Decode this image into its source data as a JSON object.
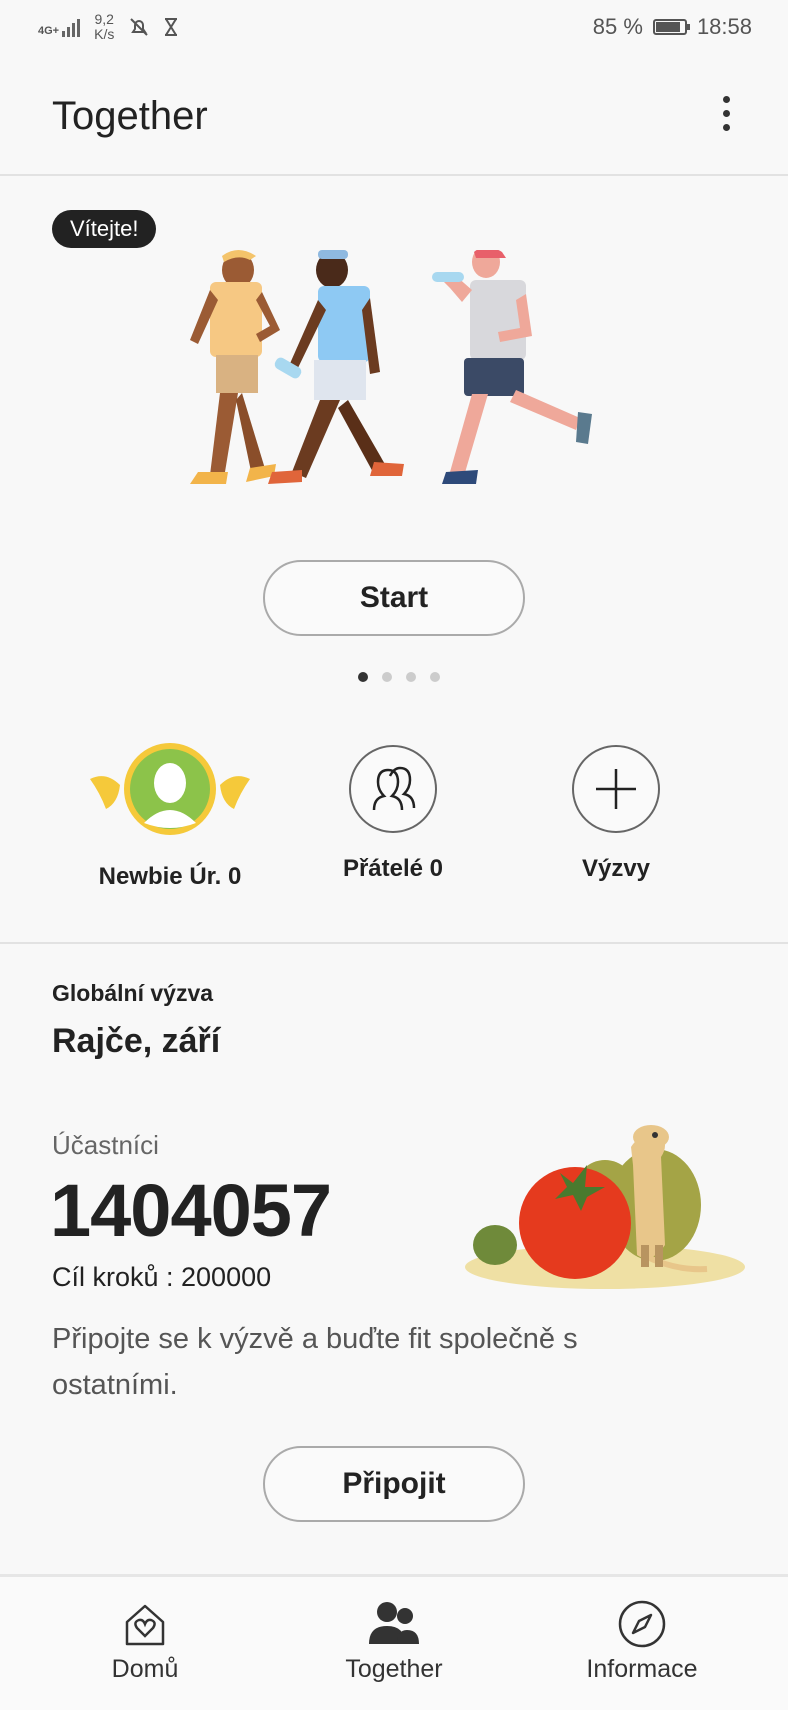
{
  "status_bar": {
    "network": "4G+",
    "speed_value": "9,2",
    "speed_unit": "K/s",
    "battery": "85 %",
    "battery_level": 0.85,
    "time": "18:58"
  },
  "header": {
    "title": "Together"
  },
  "welcome": {
    "badge": "Vítejte!",
    "start_label": "Start",
    "carousel_pages": 4,
    "carousel_active": 0
  },
  "shortcuts": [
    {
      "label": "Newbie Úr. 0",
      "icon": "newbie-level-avatar-icon"
    },
    {
      "label": "Přátelé 0",
      "icon": "friends-icon"
    },
    {
      "label": "Výzvy",
      "icon": "plus-icon"
    }
  ],
  "challenge": {
    "kicker": "Globální výzva",
    "title": "Rajče, září",
    "participants_label": "Účastníci",
    "participants": "1404057",
    "goal": "Cíl kroků : 200000",
    "description": "Připojte se k výzvě a buďte fit společně s ostatními.",
    "join_label": "Připojit"
  },
  "bottom_nav": [
    {
      "label": "Domů",
      "icon": "home-heart-icon"
    },
    {
      "label": "Together",
      "icon": "people-icon",
      "active": true
    },
    {
      "label": "Informace",
      "icon": "compass-icon"
    }
  ],
  "colors": {
    "accent_yellow": "#f5c93a",
    "avatar_green": "#8cc34a",
    "tomato": "#e53a1e",
    "badge_bg": "#222222"
  }
}
